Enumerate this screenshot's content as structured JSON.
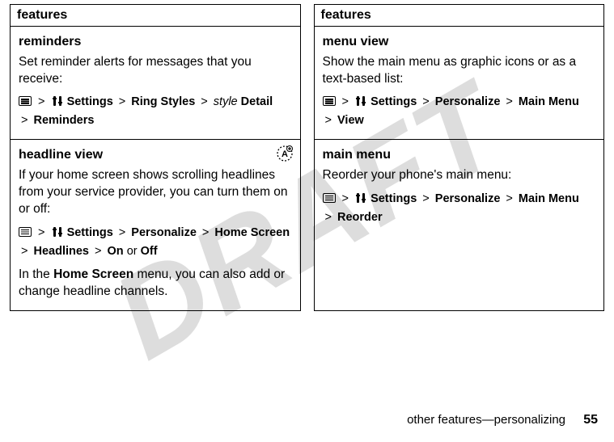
{
  "watermark": "DRAFT",
  "left": {
    "header": "features",
    "cells": [
      {
        "title": "reminders",
        "desc": "Set reminder alerts for messages that you receive:",
        "path_parts": {
          "settings": "Settings",
          "ring_styles": "Ring Styles",
          "style": "style",
          "detail": "Detail",
          "reminders": "Reminders"
        }
      },
      {
        "title": "headline view",
        "desc": "If your home screen shows scrolling headlines from your service provider, you can turn them on or off:",
        "path_parts": {
          "settings": "Settings",
          "personalize": "Personalize",
          "home_screen": "Home Screen",
          "headlines": "Headlines",
          "on": "On",
          "or": "or",
          "off": "Off"
        },
        "note_pre": "In the ",
        "note_bold": "Home Screen",
        "note_post": " menu, you can also add or change headline channels."
      }
    ]
  },
  "right": {
    "header": "features",
    "cells": [
      {
        "title": "menu view",
        "desc": "Show the main menu as graphic icons or as a text-based list:",
        "path_parts": {
          "settings": "Settings",
          "personalize": "Personalize",
          "main_menu": "Main Menu",
          "view": "View"
        }
      },
      {
        "title": "main menu",
        "desc": "Reorder your phone's main menu:",
        "path_parts": {
          "settings": "Settings",
          "personalize": "Personalize",
          "main_menu": "Main Menu",
          "reorder": "Reorder"
        }
      }
    ]
  },
  "footer": {
    "text": "other features—personalizing",
    "page": "55"
  },
  "gt": ">"
}
